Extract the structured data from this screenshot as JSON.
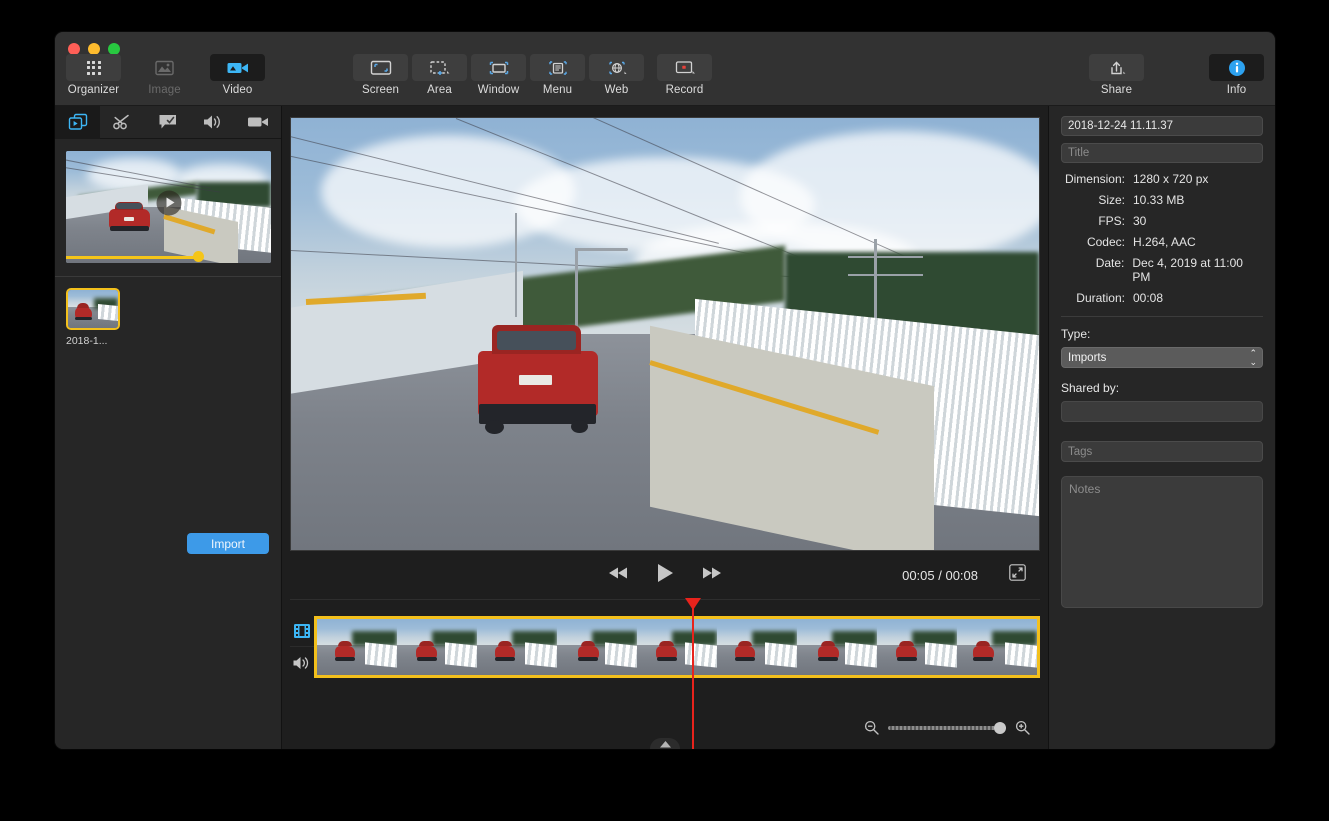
{
  "window": {
    "traffic_lights": [
      "close",
      "minimize",
      "zoom"
    ]
  },
  "toolbar": {
    "left_group": [
      {
        "label": "Organizer",
        "icon": "grid-icon",
        "state": "shaded"
      },
      {
        "label": "Image",
        "icon": "image-icon",
        "state": "disabled"
      },
      {
        "label": "Video",
        "icon": "video-camera-icon",
        "state": "active"
      }
    ],
    "capture_group": [
      {
        "label": "Screen",
        "icon": "screen-capture-icon"
      },
      {
        "label": "Area",
        "icon": "area-capture-icon"
      },
      {
        "label": "Window",
        "icon": "window-capture-icon"
      },
      {
        "label": "Menu",
        "icon": "menu-capture-icon"
      },
      {
        "label": "Web",
        "icon": "web-capture-icon"
      },
      {
        "label": "Record",
        "icon": "record-icon"
      }
    ],
    "right_group": [
      {
        "label": "Share",
        "icon": "share-icon",
        "state": "shaded"
      },
      {
        "label": "Info",
        "icon": "info-icon",
        "state": "active"
      }
    ]
  },
  "sidebar": {
    "tools": [
      {
        "name": "clips-tool",
        "icon": "media-clips-icon",
        "selected": true
      },
      {
        "name": "trim-tool",
        "icon": "scissors-icon",
        "selected": false
      },
      {
        "name": "annotate-tool",
        "icon": "callout-icon",
        "selected": false
      },
      {
        "name": "audio-tool",
        "icon": "speaker-icon",
        "selected": false
      },
      {
        "name": "camera-tool",
        "icon": "camcorder-icon",
        "selected": false
      }
    ],
    "preview": {
      "play_overlay": "play-icon",
      "scrub_percent": 63
    },
    "thumbnails": [
      {
        "label": "2018-1...",
        "selected": true
      }
    ],
    "import_label": "Import"
  },
  "player": {
    "controls": [
      {
        "name": "rewind-button",
        "icon": "rewind-icon"
      },
      {
        "name": "play-button",
        "icon": "play-icon"
      },
      {
        "name": "fast-forward-button",
        "icon": "fast-forward-icon"
      }
    ],
    "time_display": "00:05 / 00:08",
    "current_time": "00:05",
    "total_time": "00:08",
    "fullscreen_icon": "expand-icon"
  },
  "timeline": {
    "tracks": [
      {
        "name": "video-track",
        "icon": "filmstrip-icon",
        "active": true
      },
      {
        "name": "audio-track",
        "icon": "speaker-icon",
        "active": false
      }
    ],
    "playhead_percent": 52,
    "frame_count": 9,
    "zoom_out_icon": "zoom-out-icon",
    "zoom_in_icon": "zoom-in-icon",
    "zoom_percent": 92,
    "collapse_icon": "chevron-up-icon"
  },
  "inspector": {
    "filename": "2018-12-24 11.11.37",
    "title_placeholder": "Title",
    "title_value": "",
    "metadata": [
      {
        "key": "Dimension:",
        "value": "1280 x 720 px"
      },
      {
        "key": "Size:",
        "value": "10.33 MB"
      },
      {
        "key": "FPS:",
        "value": "30"
      },
      {
        "key": "Codec:",
        "value": "H.264, AAC"
      },
      {
        "key": "Date:",
        "value": "Dec 4, 2019 at 11:00 PM"
      },
      {
        "key": "Duration:",
        "value": "00:08"
      }
    ],
    "type_label": "Type:",
    "type_value": "Imports",
    "type_options": [
      "Imports"
    ],
    "shared_by_label": "Shared by:",
    "shared_by_value": "",
    "tags_placeholder": "Tags",
    "tags_value": "",
    "notes_placeholder": "Notes",
    "notes_value": ""
  },
  "colors": {
    "accent_blue": "#3d9ae8",
    "selection_yellow": "#f3c01c",
    "playhead_red": "#e8231c",
    "toolbar_bg": "#323232",
    "panel_bg": "#262626"
  }
}
